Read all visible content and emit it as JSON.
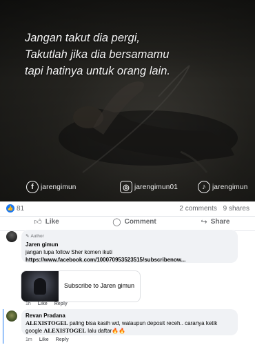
{
  "post": {
    "quote_lines": [
      "Jangan takut dia pergi,",
      "Takutlah jika dia bersamamu",
      "tapi hatinya untuk orang lain."
    ],
    "socials": [
      {
        "icon": "facebook-icon",
        "glyph": "f",
        "handle": "jarengimun"
      },
      {
        "icon": "instagram-icon",
        "glyph": "◎",
        "handle": "jarengimun01"
      },
      {
        "icon": "tiktok-icon",
        "glyph": "♪",
        "handle": "jarengimun"
      }
    ]
  },
  "stats": {
    "likes": "81",
    "comments": "2 comments",
    "shares": "9 shares"
  },
  "actions": {
    "like": "Like",
    "comment": "Comment",
    "share": "Share"
  },
  "comments": [
    {
      "author_tag": "Author",
      "name": "Jaren gimun",
      "text": "jangan lupa follow Sher komen ikuti",
      "link": "https://www.facebook.com/100070953523515/subscribenow...",
      "card_title": "Subscribe to Jaren gimun",
      "time": "1h",
      "like": "Like",
      "reply": "Reply"
    },
    {
      "name": "Revan Pradana",
      "brand": "ALEXISTOGEL",
      "text_1": " paling bisa kasih wd, walaupun deposit receh.. caranya ketik google ",
      "brand_2": "ALEXISTOGEL",
      "text_2": " lalu daftar🔥🔥",
      "time": "1m",
      "like": "Like",
      "reply": "Reply"
    }
  ],
  "colors": {
    "accent": "#1877f2",
    "bubble": "#f0f2f5",
    "muted": "#65676b"
  }
}
